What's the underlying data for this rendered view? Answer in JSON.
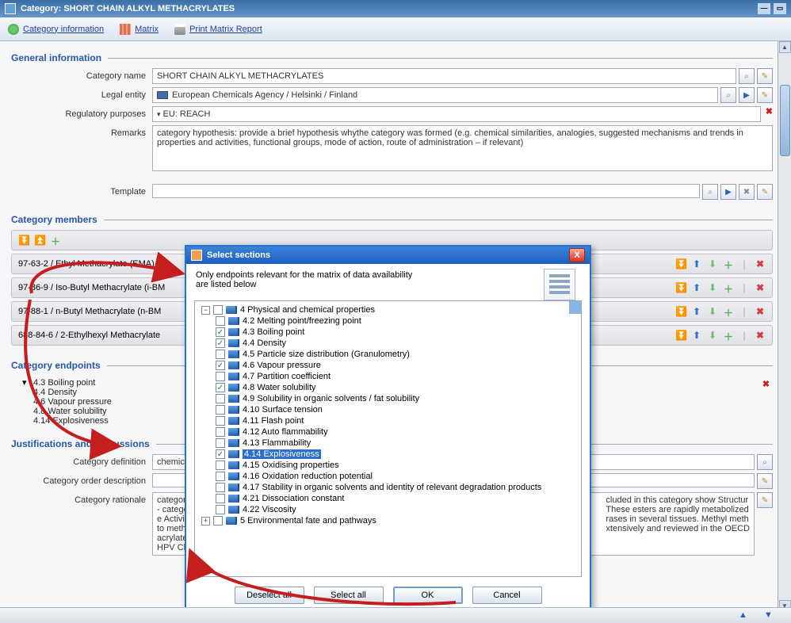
{
  "window": {
    "title": "Category: SHORT CHAIN ALKYL METHACRYLATES"
  },
  "toolbar": {
    "category_info": "Category information",
    "matrix": "Matrix",
    "print_matrix": "Print Matrix Report"
  },
  "general_info": {
    "legend": "General information",
    "category_name_label": "Category name",
    "category_name_value": "SHORT CHAIN ALKYL METHACRYLATES",
    "legal_entity_label": "Legal entity",
    "legal_entity_value": "European Chemicals Agency / Helsinki / Finland",
    "regulatory_label": "Regulatory purposes",
    "regulatory_value": "EU: REACH",
    "remarks_label": "Remarks",
    "remarks_value": "category hypothesis: provide a brief hypothesis whythe category was formed  (e.g. chemical similarities, analogies, suggested mechanisms and trends in properties and activities, functional groups, mode of action, route of administration – if relevant)",
    "template_label": "Template"
  },
  "members": {
    "legend": "Category members",
    "items": [
      "97-63-2 / Ethyl Methacrylate (EMA)",
      "97-86-9 / Iso-Butyl Methacrylate (i-BM",
      "97-88-1 / n-Butyl Methacrylate (n-BM",
      "688-84-6 / 2-Ethylhexyl Methacrylate"
    ]
  },
  "endpoints": {
    "legend": "Category endpoints",
    "items": [
      "4.3 Boiling point",
      "4.4 Density",
      "4.6 Vapour pressure",
      "4.8 Water solubility",
      "4.14 Explosiveness"
    ]
  },
  "justifications": {
    "legend": "Justifications and discussions",
    "category_definition_label": "Category definition",
    "category_definition_value": "chemical ca",
    "category_order_label": "Category order description",
    "category_rationale_label": "Category rationale",
    "category_rationale_value": "category a...\n- category J\ne Activity Re\nto methacry\nacrylate (M\nHPV Chemi",
    "rationale_right": "cluded in this category show Structur\nThese esters are rapidly metabolized\nrases in several tissues.  Methyl meth\nxtensively and reviewed in the OECD"
  },
  "modal": {
    "title": "Select sections",
    "hint": "Only endpoints relevant for the matrix of data availability\nare listed below",
    "root1": "4 Physical and chemical properties",
    "items": [
      {
        "label": "4.2 Melting point/freezing point",
        "checked": false
      },
      {
        "label": "4.3 Boiling point",
        "checked": true
      },
      {
        "label": "4.4 Density",
        "checked": true
      },
      {
        "label": "4.5 Particle size distribution (Granulometry)",
        "checked": false
      },
      {
        "label": "4.6 Vapour pressure",
        "checked": true
      },
      {
        "label": "4.7 Partition coefficient",
        "checked": false
      },
      {
        "label": "4.8 Water solubility",
        "checked": true
      },
      {
        "label": "4.9 Solubility in organic solvents / fat solubility",
        "checked": false
      },
      {
        "label": "4.10 Surface tension",
        "checked": false
      },
      {
        "label": "4.11 Flash point",
        "checked": false
      },
      {
        "label": "4.12 Auto flammability",
        "checked": false
      },
      {
        "label": "4.13 Flammability",
        "checked": false
      },
      {
        "label": "4.14 Explosiveness",
        "checked": true,
        "selected": true
      },
      {
        "label": "4.15 Oxidising properties",
        "checked": false
      },
      {
        "label": "4.16 Oxidation reduction potential",
        "checked": false
      },
      {
        "label": "4.17 Stability in organic solvents and identity of relevant degradation products",
        "checked": false
      },
      {
        "label": "4.21 Dissociation constant",
        "checked": false
      },
      {
        "label": "4.22 Viscosity",
        "checked": false
      }
    ],
    "root2": "5 Environmental fate and pathways",
    "buttons": {
      "deselect": "Deselect all",
      "select": "Select all",
      "ok": "OK",
      "cancel": "Cancel"
    }
  }
}
